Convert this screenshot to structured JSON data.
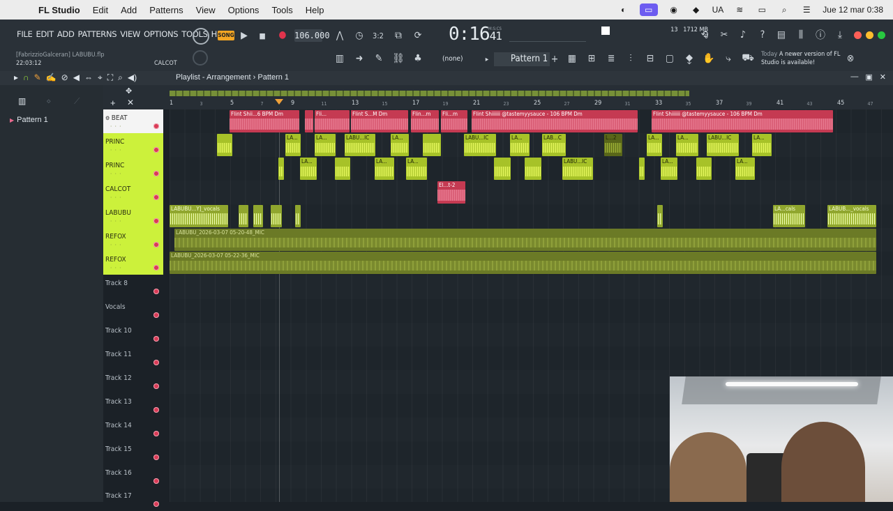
{
  "macbar": {
    "app": "FL Studio",
    "menus": [
      "FL Studio",
      "Edit",
      "Add",
      "Patterns",
      "View",
      "Options",
      "Tools",
      "Help"
    ],
    "language": "UA",
    "datetime": "Jue 12 mar 0:38"
  },
  "toolbar": {
    "menu": [
      "FILE",
      "EDIT",
      "ADD",
      "PATTERNS",
      "VIEW",
      "OPTIONS",
      "TOOLS",
      "HELP"
    ],
    "project_name": "[FabrizzioGalceran] LABUBU.flp",
    "project_time": "22:03:12",
    "hint_track": "CALCOT",
    "song_mode": "SONG",
    "tempo": "106.000",
    "time_main": "0:16",
    "time_frac": "41",
    "time_unit": "M:S:CS",
    "cpu_voices": "13",
    "memory": "1712 MB",
    "cpu_zero": "0",
    "channel_selector": "(none)",
    "pattern_selector": "Pattern 1",
    "news_prefix": "Today",
    "news_text": "A newer version of FL Studio is available!"
  },
  "playlist": {
    "breadcrumb": "Playlist - Arrangement",
    "pattern": "Pattern 1",
    "picker_pattern": "Pattern 1",
    "ruler": [
      "1",
      "3",
      "5",
      "7",
      "9",
      "11",
      "13",
      "15",
      "17",
      "19",
      "21",
      "23",
      "25",
      "27",
      "29",
      "31",
      "33",
      "35",
      "37",
      "39",
      "41",
      "43",
      "45",
      "47"
    ],
    "tracks": [
      {
        "name": "BEAT",
        "style": "white"
      },
      {
        "name": "PRINC",
        "style": "lime"
      },
      {
        "name": "PRINC",
        "style": "lime"
      },
      {
        "name": "CALCOT",
        "style": "lime"
      },
      {
        "name": "LABUBU",
        "style": "lime"
      },
      {
        "name": "REFOX",
        "style": "lime"
      },
      {
        "name": "REFOX",
        "style": "lime"
      },
      {
        "name": "Track 8",
        "style": "dark"
      },
      {
        "name": "Vocals",
        "style": "dark"
      },
      {
        "name": "Track 10",
        "style": "dark"
      },
      {
        "name": "Track 11",
        "style": "dark"
      },
      {
        "name": "Track 12",
        "style": "dark"
      },
      {
        "name": "Track 13",
        "style": "dark"
      },
      {
        "name": "Track 14",
        "style": "dark"
      },
      {
        "name": "Track 15",
        "style": "dark"
      },
      {
        "name": "Track 16",
        "style": "dark"
      },
      {
        "name": "Track 17",
        "style": "dark"
      }
    ],
    "clips": {
      "beat": [
        "Flint Shii...6 BPM Dm",
        "Fli...",
        "Flint S...M Dm",
        "Flin...m",
        "Fli...m",
        "Flint Shiiiiii @tastemyysauce - 106 BPM Dm",
        "Flint Shiiiiii @tastemyysauce - 106 BPM Dm"
      ],
      "princ1": [
        "LA...",
        "LABU...IC",
        "LA...",
        "LABU...IC",
        "LA...",
        "LAB...C",
        "L...2",
        "LA...",
        "LA...",
        "LABU...IC",
        "LA..."
      ],
      "princ2": [
        "LA...",
        "LA...",
        "LA...",
        "LABU...IC",
        "LA...",
        "LA..."
      ],
      "calcot": [
        "El...t-2"
      ],
      "labubu": [
        "LABUBU...Y]_vocals",
        "LA...cals",
        "LABUB..._vocals"
      ],
      "refox1": "LABUBU_2026-03-07 05-20-48_MIC",
      "refox2": "LABUBU_2026-03-07 05-22-36_MIC"
    }
  },
  "colors": {
    "track_lime": "#ccf13b",
    "clip_red": "#c53a52",
    "record": "#e0334c"
  }
}
